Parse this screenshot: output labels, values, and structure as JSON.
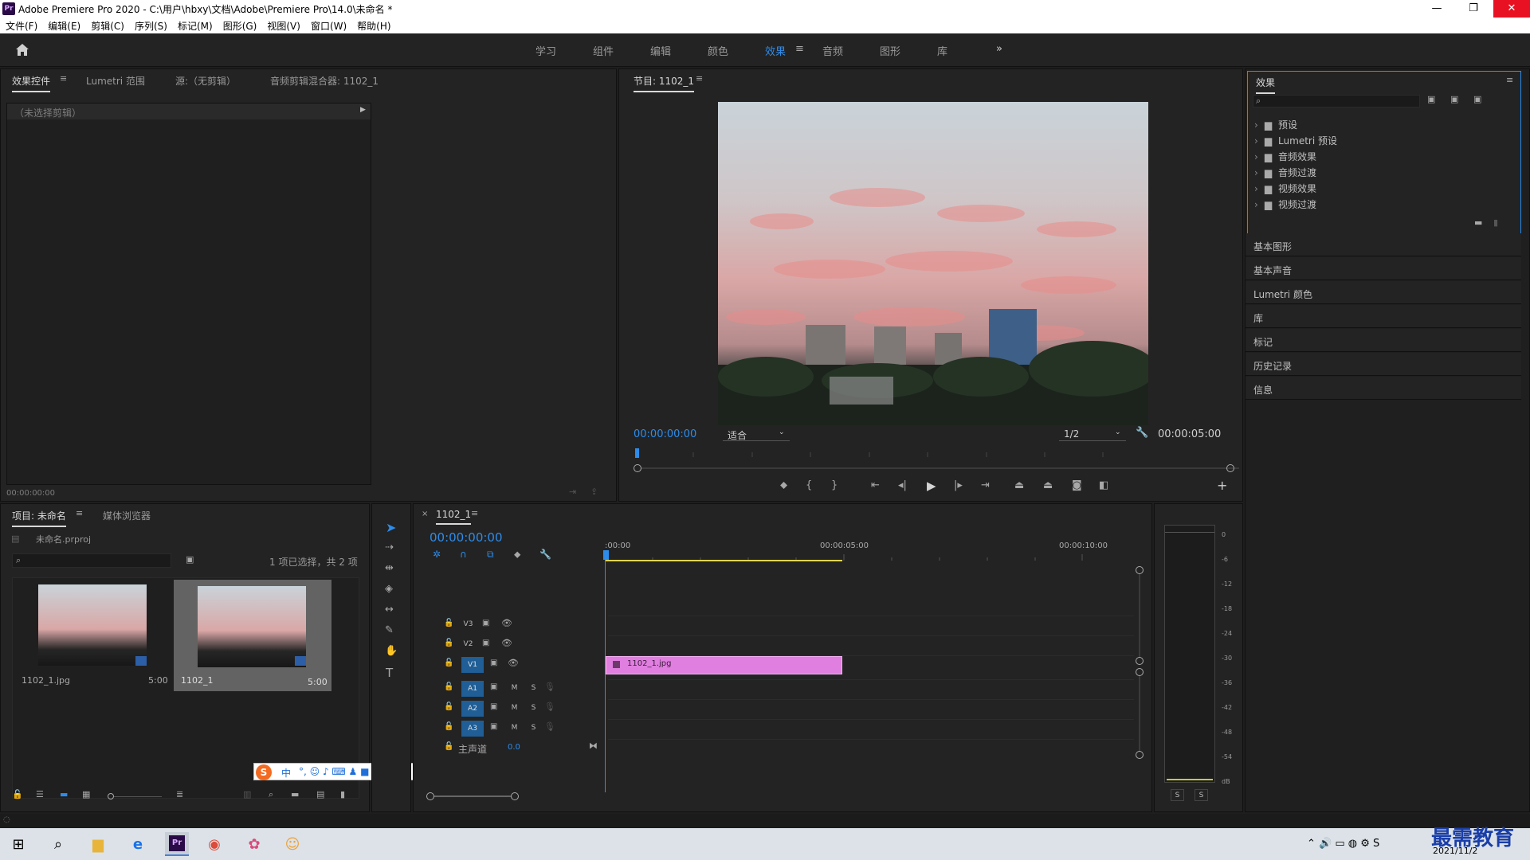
{
  "window": {
    "app_title": "Adobe Premiere Pro 2020 - C:\\用户\\hbxy\\文档\\Adobe\\Premiere Pro\\14.0\\未命名 *",
    "logo_text": "Pr",
    "minimize": "—",
    "restore": "❐",
    "close": "✕"
  },
  "menu": [
    "文件(F)",
    "编辑(E)",
    "剪辑(C)",
    "序列(S)",
    "标记(M)",
    "图形(G)",
    "视图(V)",
    "窗口(W)",
    "帮助(H)"
  ],
  "workspaces": {
    "tabs": [
      "学习",
      "组件",
      "编辑",
      "颜色",
      "效果",
      "音频",
      "图形",
      "库"
    ],
    "active": "效果",
    "more": "»"
  },
  "source_panel": {
    "tabs": [
      "效果控件",
      "Lumetri 范围",
      "源:（无剪辑）",
      "音频剪辑混合器: 1102_1"
    ],
    "no_clip": "（未选择剪辑）",
    "timecode": "00:00:00:00"
  },
  "program": {
    "title": "节目: 1102_1",
    "timecode_left": "00:00:00:00",
    "fit_label": "适合",
    "resolution": "1/2",
    "timecode_right": "00:00:05:00"
  },
  "project": {
    "tabs": [
      "项目: 未命名",
      "媒体浏览器"
    ],
    "file": "未命名.prproj",
    "selection_info": "1 项已选择，共 2 项",
    "items": [
      {
        "name": "1102_1.jpg",
        "duration": "5:00"
      },
      {
        "name": "1102_1",
        "duration": "5:00"
      }
    ]
  },
  "ime": {
    "text": "中"
  },
  "timeline": {
    "sequence_tab": "1102_1",
    "timecode": "00:00:00:00",
    "ruler": [
      ":00:00",
      "00:00:05:00",
      "00:00:10:00"
    ],
    "tracks": [
      {
        "name": "V3",
        "kind": "video"
      },
      {
        "name": "V2",
        "kind": "video"
      },
      {
        "name": "V1",
        "kind": "video"
      },
      {
        "name": "A1",
        "kind": "audio"
      },
      {
        "name": "A2",
        "kind": "audio"
      },
      {
        "name": "A3",
        "kind": "audio"
      }
    ],
    "mute": "M",
    "solo": "S",
    "master_label": "主声道",
    "master_value": "0.0",
    "clip_name": "1102_1.jpg"
  },
  "meter": {
    "scale": [
      "0",
      "-6",
      "-12",
      "-18",
      "-24",
      "-30",
      "-36",
      "-42",
      "-48",
      "-54",
      "dB"
    ],
    "solo_left": "S",
    "solo_right": "S"
  },
  "effects": {
    "title": "效果",
    "folders": [
      "预设",
      "Lumetri 预设",
      "音频效果",
      "音频过渡",
      "视频效果",
      "视频过渡"
    ]
  },
  "side_panels": [
    "基本图形",
    "基本声音",
    "Lumetri 颜色",
    "库",
    "标记",
    "历史记录",
    "信息"
  ],
  "taskbar": {
    "date": "2021/11/2",
    "watermark": "最需教育"
  },
  "colors": {
    "accent": "#2d8ceb",
    "clip": "#e07fe0",
    "panel": "#232323",
    "close": "#e81123"
  }
}
